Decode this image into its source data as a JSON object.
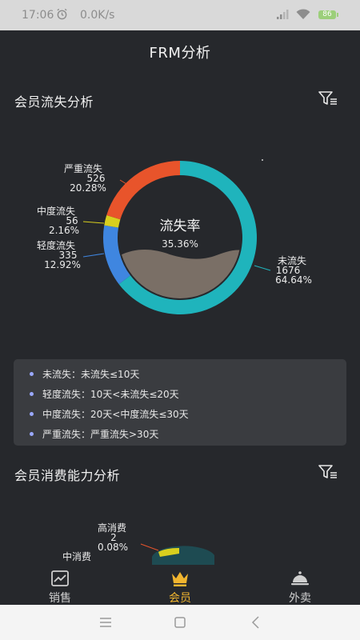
{
  "status_bar": {
    "time": "17:06",
    "speed": "0.0K/s",
    "battery": "86"
  },
  "header": {
    "title": "FRM分析"
  },
  "section1": {
    "title": "会员流失分析",
    "filter_icon": "filter-icon",
    "center_label": "流失率",
    "center_value": "35.36%"
  },
  "chart_data": [
    {
      "type": "pie",
      "title": "会员流失分析",
      "slices": [
        {
          "name": "未流失",
          "value": 1676,
          "percent": "64.64%",
          "color": "#1fb4bc"
        },
        {
          "name": "轻度流失",
          "value": 335,
          "percent": "12.92%",
          "color": "#3f86e0"
        },
        {
          "name": "中度流失",
          "value": 56,
          "percent": "2.16%",
          "color": "#d8cf1e"
        },
        {
          "name": "严重流失",
          "value": 526,
          "percent": "20.28%",
          "color": "#e8542b"
        }
      ],
      "center_label": "流失率",
      "center_value": "35.36%"
    },
    {
      "type": "pie",
      "title": "会员消费能力分析",
      "slices": [
        {
          "name": "高消费",
          "value": 2,
          "percent": "0.08%",
          "color": "#e8542b"
        },
        {
          "name": "中消费",
          "value": null,
          "percent": "",
          "color": "#d8cf1e"
        }
      ]
    }
  ],
  "legend": {
    "items": [
      "未流失：未流失≤10天",
      "轻度流失：10天<未流失≤20天",
      "中度流失：20天<中度流失≤30天",
      "严重流失：严重流失>30天"
    ]
  },
  "section2": {
    "title": "会员消费能力分析",
    "filter_icon": "filter-icon"
  },
  "tabs": [
    {
      "label": "销售",
      "icon": "sales-chart-icon",
      "active": false
    },
    {
      "label": "会员",
      "icon": "crown-icon",
      "active": true
    },
    {
      "label": "外卖",
      "icon": "food-cloche-icon",
      "active": false
    }
  ],
  "nav": {
    "menu": "menu-icon",
    "home": "home-icon",
    "back": "back-icon"
  }
}
